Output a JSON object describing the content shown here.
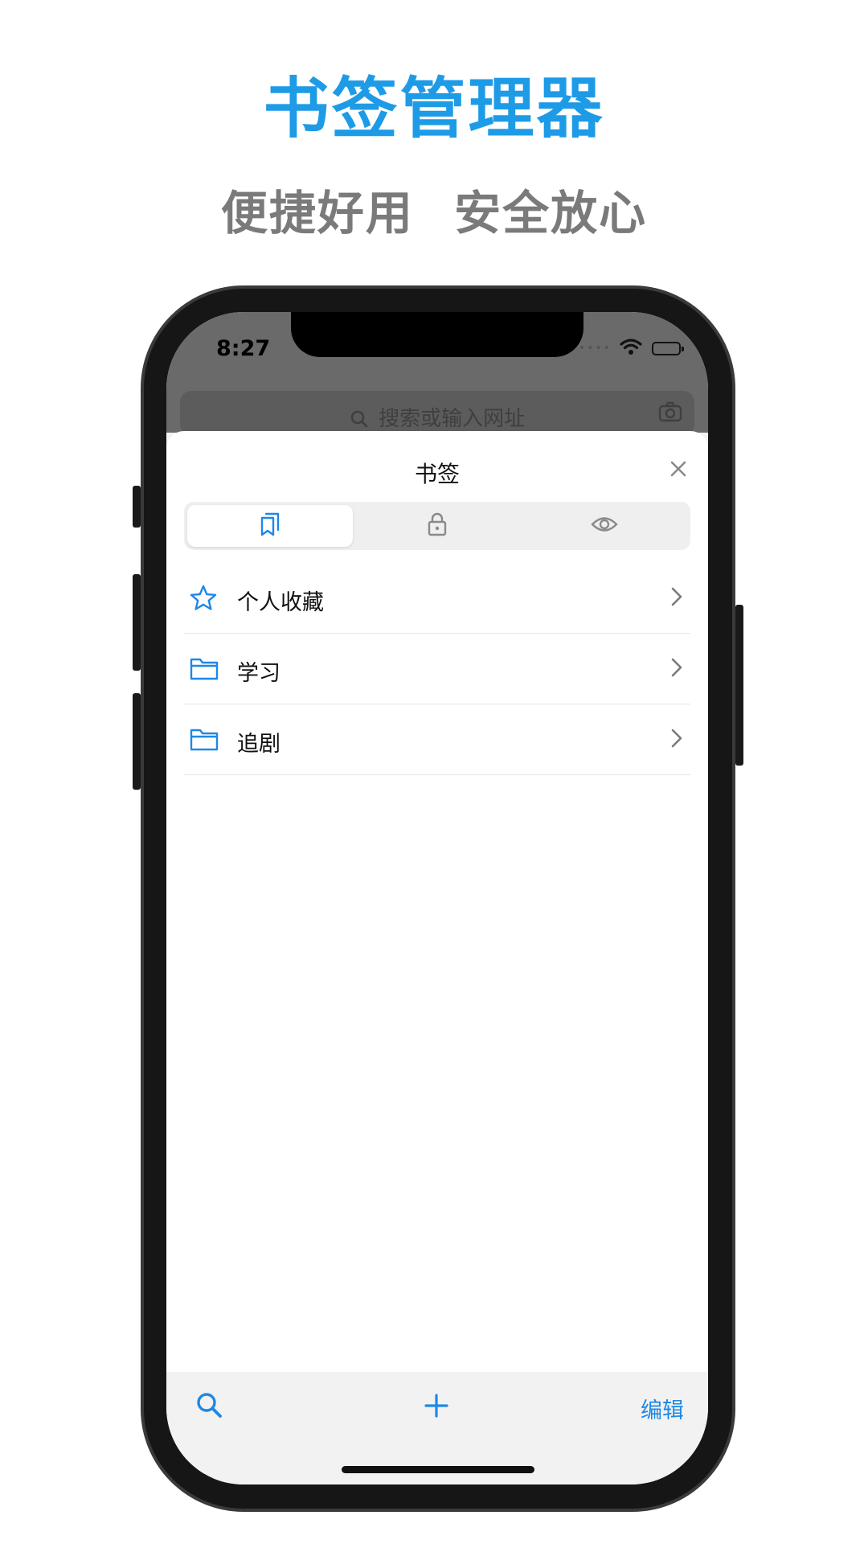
{
  "promo": {
    "title": "书签管理器",
    "subtitle": "便捷好用 安全放心"
  },
  "status_bar": {
    "time": "8:27",
    "signal_dots": "••••"
  },
  "browser": {
    "search_placeholder": "搜索或输入网址"
  },
  "sheet": {
    "title": "书签",
    "tabs": [
      {
        "icon": "bookmarks-icon",
        "active": true
      },
      {
        "icon": "lock-icon",
        "active": false
      },
      {
        "icon": "eye-icon",
        "active": false
      }
    ],
    "items": [
      {
        "label": "个人收藏",
        "icon": "star-icon"
      },
      {
        "label": "学习",
        "icon": "folder-icon"
      },
      {
        "label": "追剧",
        "icon": "folder-icon"
      }
    ]
  },
  "toolbar": {
    "edit_label": "编辑"
  },
  "colors": {
    "accent": "#1e88e5",
    "title_blue": "#1e9be6",
    "subtitle_gray": "#7a7a7a"
  }
}
